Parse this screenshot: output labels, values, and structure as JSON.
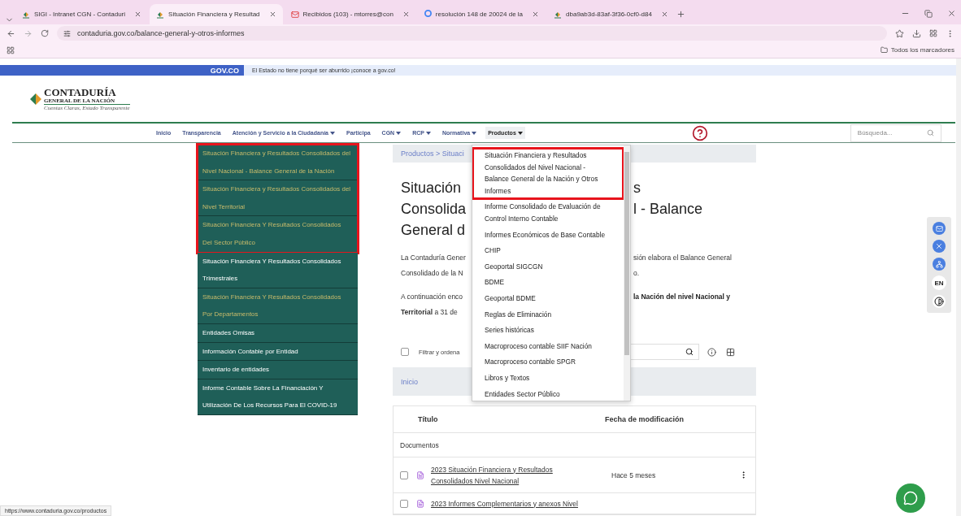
{
  "browser": {
    "tabs": [
      {
        "label": "SIGI - Intranet CGN - Contaduri",
        "selected": false
      },
      {
        "label": "Situación Financiera y Resultad",
        "selected": true
      },
      {
        "label": "Recibidos (103) - mtorres@con",
        "selected": false
      },
      {
        "label": "resolución 148 de 20024 de la",
        "selected": false
      },
      {
        "label": "dba9ab3d-83af-3f36-0cf0-d84",
        "selected": false
      }
    ],
    "address": "contaduria.gov.co/balance-general-y-otros-informes",
    "bookmarks_folder": "Todos los marcadores",
    "status_url": "https://www.contaduria.gov.co/productos"
  },
  "gov_bar": {
    "brand": "GOV.CO",
    "message": "El Estado no tiene porqué ser aburrido ¡conoce a gov.co!"
  },
  "logo": {
    "name": "CONTADURÍA",
    "subtitle": "GENERAL DE LA NACIÓN",
    "tagline": "Cuentas Claras, Estado Transparente"
  },
  "nav": {
    "items": [
      {
        "label": "Inicio",
        "has_menu": false,
        "selected": false
      },
      {
        "label": "Transparencia",
        "has_menu": false,
        "selected": false
      },
      {
        "label": "Atención y Servicio a la Ciudadanía",
        "has_menu": true,
        "selected": false
      },
      {
        "label": "Participa",
        "has_menu": false,
        "selected": false
      },
      {
        "label": "CGN",
        "has_menu": true,
        "selected": false
      },
      {
        "label": "RCP",
        "has_menu": true,
        "selected": false
      },
      {
        "label": "Normativa",
        "has_menu": true,
        "selected": false
      },
      {
        "label": "Productos",
        "has_menu": true,
        "selected": true
      }
    ],
    "search": {
      "placeholder": "Búsqueda..."
    }
  },
  "sidebar": {
    "items": [
      {
        "label": "Situación Financiera y Resultados Consolidados del Nivel Nacional - Balance General de la Nación",
        "visited": true,
        "highlighted": true
      },
      {
        "label": "Situación Financiera y Resultados Consolidados del Nivel Territorial",
        "visited": true,
        "highlighted": true
      },
      {
        "label": "Situación Financiera Y Resultados Consolidados Del Sector Público",
        "visited": true,
        "highlighted": true
      },
      {
        "label": "Situación Financiera Y Resultados Consolidados Trimestrales",
        "visited": false,
        "highlighted": false
      },
      {
        "label": "Situación Financiera Y Resultados Consolidados Por Departamentos",
        "visited": true,
        "highlighted": false
      },
      {
        "label": "Entidades Omisas",
        "visited": false,
        "highlighted": false
      },
      {
        "label": "Información Contable por Entidad",
        "visited": false,
        "highlighted": false
      },
      {
        "label": "Inventario de entidades",
        "visited": false,
        "highlighted": false
      },
      {
        "label": "Informe Contable Sobre La Financiación Y Utilización De Los Recursos Para El COVID-19",
        "visited": false,
        "highlighted": false
      }
    ]
  },
  "dropdown": {
    "items": [
      {
        "label": "Situación Financiera y Resultados Consolidados del Nivel Nacional - Balance General de la Nación y Otros Informes",
        "highlighted": true
      },
      {
        "label": "Informe Consolidado de Evaluación de Control Interno Contable",
        "highlighted": false
      },
      {
        "label": "Informes Económicos de Base Contable",
        "highlighted": false
      },
      {
        "label": "CHIP",
        "highlighted": false
      },
      {
        "label": "Geoportal SIGCGN",
        "highlighted": false
      },
      {
        "label": "BDME",
        "highlighted": false
      },
      {
        "label": "Geoportal BDME",
        "highlighted": false
      },
      {
        "label": "Reglas de Eliminación",
        "highlighted": false
      },
      {
        "label": "Series históricas",
        "highlighted": false
      },
      {
        "label": "Macroproceso contable SIIF Nación",
        "highlighted": false
      },
      {
        "label": "Macroproceso contable SPGR",
        "highlighted": false
      },
      {
        "label": "Libros y Textos",
        "highlighted": false
      },
      {
        "label": "Entidades Sector Público",
        "highlighted": false
      }
    ]
  },
  "main": {
    "breadcrumb": "Productos > Situaci",
    "heading_lines": [
      {
        "left": "Situación",
        "right": "s"
      },
      {
        "left": "Consolida",
        "right": "l - Balance"
      },
      {
        "left": "General d"
      }
    ],
    "paragraph_1": [
      {
        "left": "La Contaduría Gener",
        "right": "sión elabora el Balance General"
      },
      {
        "left": "Consolidado de la N",
        "right": "o."
      }
    ],
    "paragraph_2": [
      {
        "left": "A continuación enco",
        "right": "la Nación del nivel Nacional y"
      },
      {
        "left": "**Territorial** a 31 de"
      }
    ],
    "filter": {
      "label": "Filtrar y ordena",
      "checked": false
    },
    "folder_bar": "Inicio",
    "table": {
      "columns": [
        "Título",
        "Fecha de modificación"
      ],
      "section": "Documentos",
      "rows": [
        {
          "title": "2023 Situación Financiera y Resultados Consolidados Nivel Nacional",
          "modified": "Hace 5 meses",
          "checked": false
        },
        {
          "title": "2023 Informes Complementarios y anexos Nivel",
          "checked": false
        }
      ]
    }
  },
  "accessibility_bar": {
    "language": "EN"
  }
}
